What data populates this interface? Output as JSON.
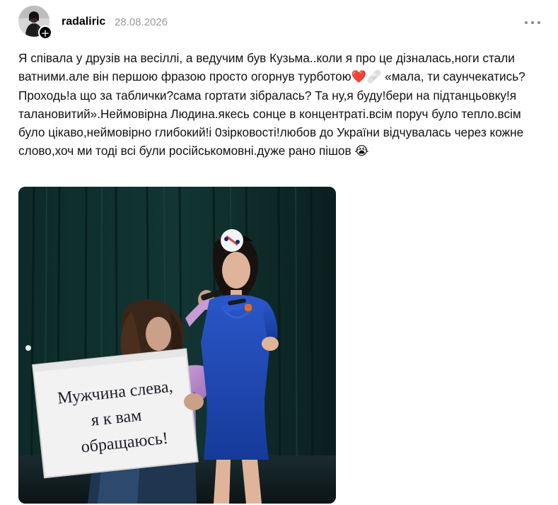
{
  "post": {
    "username": "radaliric",
    "date": "28.08.2026",
    "follow_icon": "plus-icon",
    "menu_icon": "more-horizontal-icon",
    "text": "Я співала у друзів на весіллі, а ведучим був Кузьма..коли я про це дізналась,ноги стали ватними.але він першою фразою просто огорнув турботою❤️🩹 «мала, ти саунчекатись?Проходь!а що за таблички?сама гортати зібралась? Та ну,я буду!бери на підтанцьовку!я талановитий».Неймовірна Людина.якесь сонце в концентраті.всім поруч було тепло.всім було цікаво,неймовірно глибокий!і 0зірковості!любов до України відчувалась через кожне слово,хоч ми тоді всі були російськомовні.дуже рано пішов 😭",
    "photo": {
      "sign_lines": [
        "Мужчина слева,",
        "я к вам",
        "обращаюсь!"
      ]
    }
  }
}
